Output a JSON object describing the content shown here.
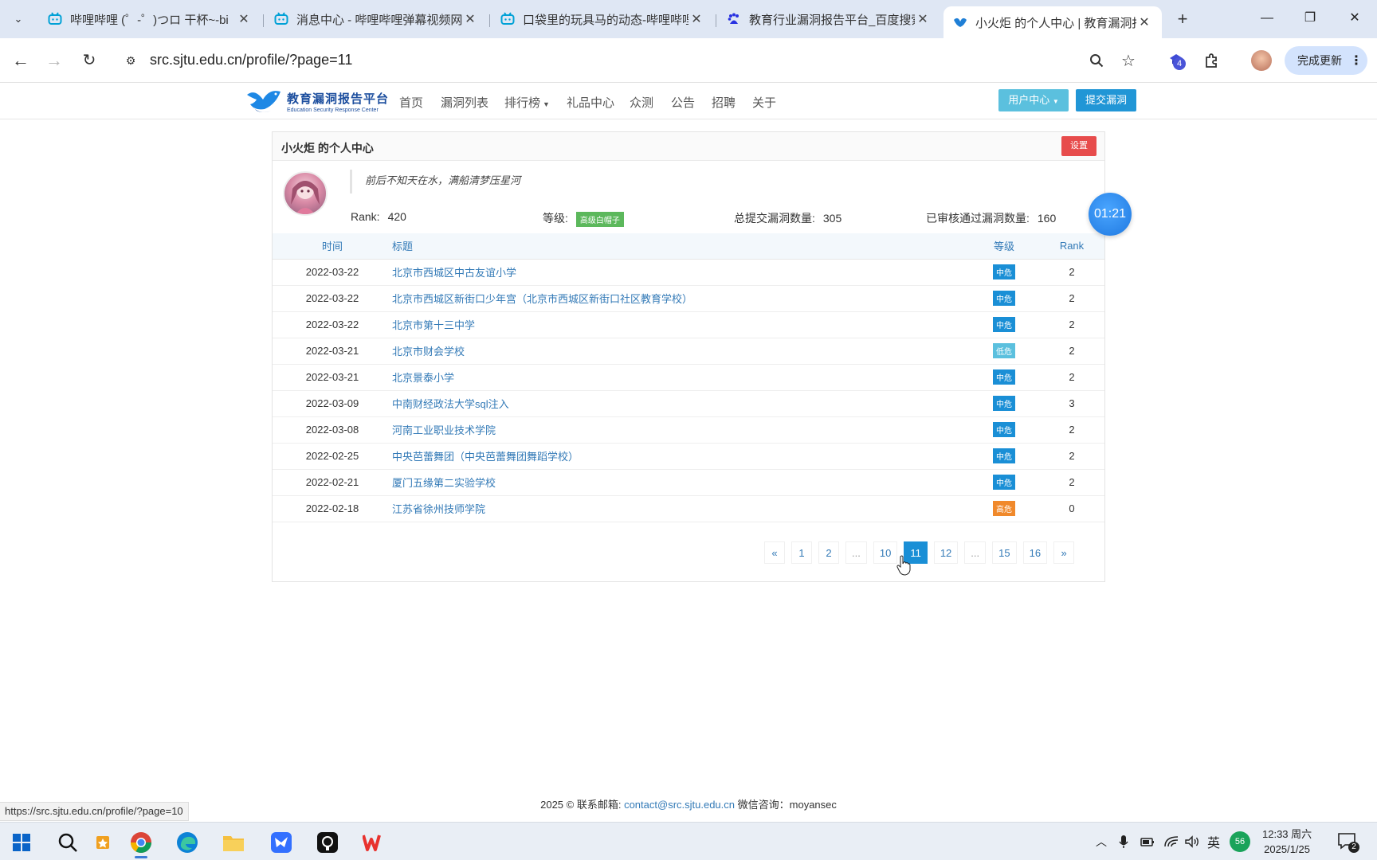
{
  "browser": {
    "tabs": [
      {
        "title": "哔哩哔哩 (゜-゜)つロ 干杯~-bi",
        "favicon": "bilibili-icon"
      },
      {
        "title": "消息中心 - 哔哩哔哩弹幕视频网",
        "favicon": "bilibili-icon"
      },
      {
        "title": "口袋里的玩具马的动态-哔哩哔哩",
        "favicon": "bilibili-icon"
      },
      {
        "title": "教育行业漏洞报告平台_百度搜索",
        "favicon": "baidu-icon"
      },
      {
        "title": "小火炬 的个人中心 | 教育漏洞报",
        "favicon": "edusrc-icon"
      }
    ],
    "url": "src.sjtu.edu.cn/profile/?page=11",
    "extension_badge": "4",
    "update_label": "完成更新",
    "status_url": "https://src.sjtu.edu.cn/profile/?page=10"
  },
  "site": {
    "logo_cn": "教育漏洞报告平台",
    "logo_en": "Education Security Response Center",
    "nav": [
      "首页",
      "漏洞列表",
      "排行榜",
      "礼品中心",
      "众测",
      "公告",
      "招聘",
      "关于"
    ],
    "user_center": "用户中心",
    "submit": "提交漏洞"
  },
  "profile": {
    "title": "小火炬 的个人中心",
    "settings_label": "设置",
    "quote": "前后不知天在水，满船清梦压星河",
    "rank_label": "Rank:",
    "rank_value": "420",
    "level_label": "等级:",
    "level_value": "高级白帽子",
    "submitted_label": "总提交漏洞数量:",
    "submitted_value": "305",
    "approved_label": "已审核通过漏洞数量:",
    "approved_value": "160"
  },
  "timer": "01:21",
  "table": {
    "headers": [
      "时间",
      "标题",
      "等级",
      "Rank"
    ],
    "rows": [
      {
        "date": "2022-03-22",
        "title": "北京市西城区中古友谊小学",
        "level": "中危",
        "level_type": "mid",
        "rank": "2"
      },
      {
        "date": "2022-03-22",
        "title": "北京市西城区新街口少年宫（北京市西城区新街口社区教育学校）",
        "level": "中危",
        "level_type": "mid",
        "rank": "2"
      },
      {
        "date": "2022-03-22",
        "title": "北京市第十三中学",
        "level": "中危",
        "level_type": "mid",
        "rank": "2"
      },
      {
        "date": "2022-03-21",
        "title": "北京市财会学校",
        "level": "低危",
        "level_type": "low",
        "rank": "2"
      },
      {
        "date": "2022-03-21",
        "title": "北京景泰小学",
        "level": "中危",
        "level_type": "mid",
        "rank": "2"
      },
      {
        "date": "2022-03-09",
        "title": "中南财经政法大学sql注入",
        "level": "中危",
        "level_type": "mid",
        "rank": "3"
      },
      {
        "date": "2022-03-08",
        "title": "河南工业职业技术学院",
        "level": "中危",
        "level_type": "mid",
        "rank": "2"
      },
      {
        "date": "2022-02-25",
        "title": "中央芭蕾舞团（中央芭蕾舞团舞蹈学校）",
        "level": "中危",
        "level_type": "mid",
        "rank": "2"
      },
      {
        "date": "2022-02-21",
        "title": "厦门五缘第二实验学校",
        "level": "中危",
        "level_type": "mid",
        "rank": "2"
      },
      {
        "date": "2022-02-18",
        "title": "江苏省徐州技师学院",
        "level": "高危",
        "level_type": "high",
        "rank": "0"
      }
    ]
  },
  "pagination": {
    "items": [
      {
        "label": "«",
        "active": false
      },
      {
        "label": "1",
        "active": false
      },
      {
        "label": "2",
        "active": false
      },
      {
        "label": "...",
        "active": false
      },
      {
        "label": "10",
        "active": false
      },
      {
        "label": "11",
        "active": true
      },
      {
        "label": "12",
        "active": false
      },
      {
        "label": "...",
        "active": false
      },
      {
        "label": "15",
        "active": false
      },
      {
        "label": "16",
        "active": false
      },
      {
        "label": "»",
        "active": false
      }
    ]
  },
  "footer": {
    "prefix": "2025 © 联系邮箱:",
    "email": "contact@src.sjtu.edu.cn",
    "suffix": "微信咨询：moyansec"
  },
  "taskbar": {
    "ime": "英",
    "battery": "56",
    "time": "12:33 周六",
    "date": "2025/1/25",
    "notifications": "2"
  },
  "colors": {
    "accent": "#1a8fd6",
    "link": "#337ab7",
    "danger": "#e74c4c",
    "medium": "#1a8fd6",
    "low": "#5bc0de",
    "high": "#f0892b"
  }
}
